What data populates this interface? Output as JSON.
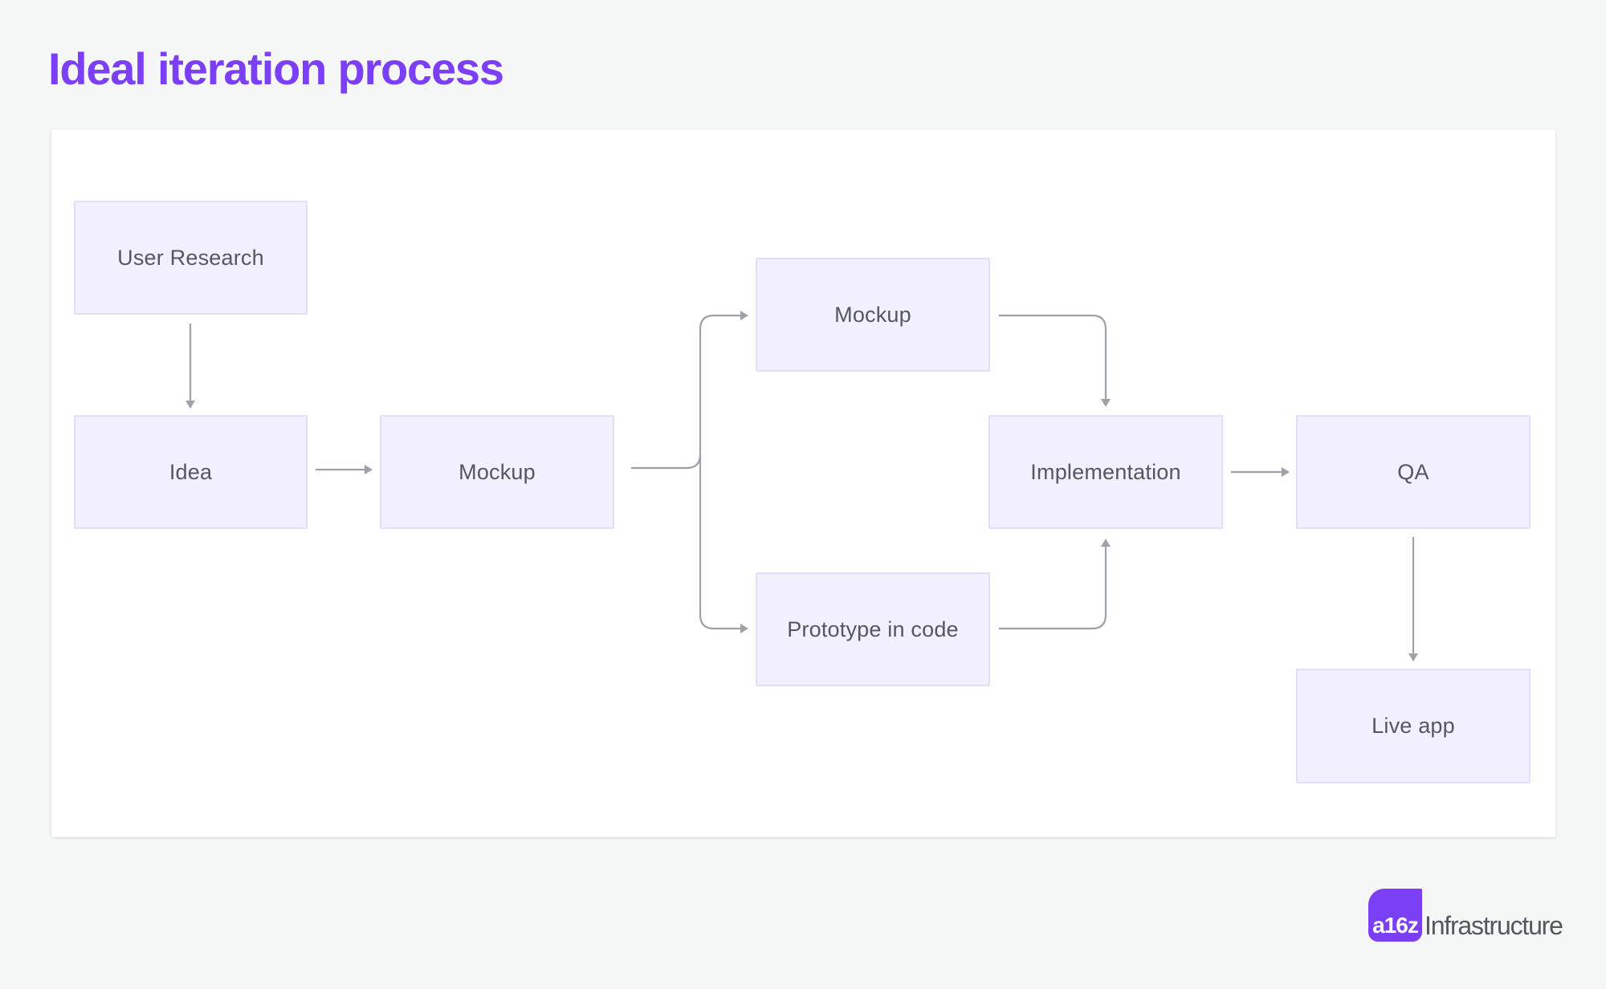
{
  "title": "Ideal iteration process",
  "colors": {
    "title": "#7b3ff6",
    "node_fill": "#f2f0fe",
    "node_border": "#e4defd",
    "node_text": "#55575f",
    "edge": "#9fa1a8",
    "background": "#f5f6f6",
    "card": "#ffffff"
  },
  "diagram": {
    "nodes": [
      {
        "id": "user-research",
        "label": "User Research"
      },
      {
        "id": "idea",
        "label": "Idea"
      },
      {
        "id": "mockup-1",
        "label": "Mockup"
      },
      {
        "id": "mockup-2",
        "label": "Mockup"
      },
      {
        "id": "prototype",
        "label": "Prototype in code"
      },
      {
        "id": "implementation",
        "label": "Implementation"
      },
      {
        "id": "qa",
        "label": "QA"
      },
      {
        "id": "live-app",
        "label": "Live app"
      }
    ],
    "edges": [
      {
        "from": "user-research",
        "to": "idea"
      },
      {
        "from": "idea",
        "to": "mockup-1"
      },
      {
        "from": "mockup-1",
        "to": "mockup-2"
      },
      {
        "from": "mockup-1",
        "to": "prototype"
      },
      {
        "from": "mockup-2",
        "to": "implementation"
      },
      {
        "from": "prototype",
        "to": "implementation"
      },
      {
        "from": "implementation",
        "to": "qa"
      },
      {
        "from": "qa",
        "to": "live-app"
      }
    ]
  },
  "branding": {
    "logo_mark": "a16z",
    "logo_text": "Infrastructure"
  }
}
